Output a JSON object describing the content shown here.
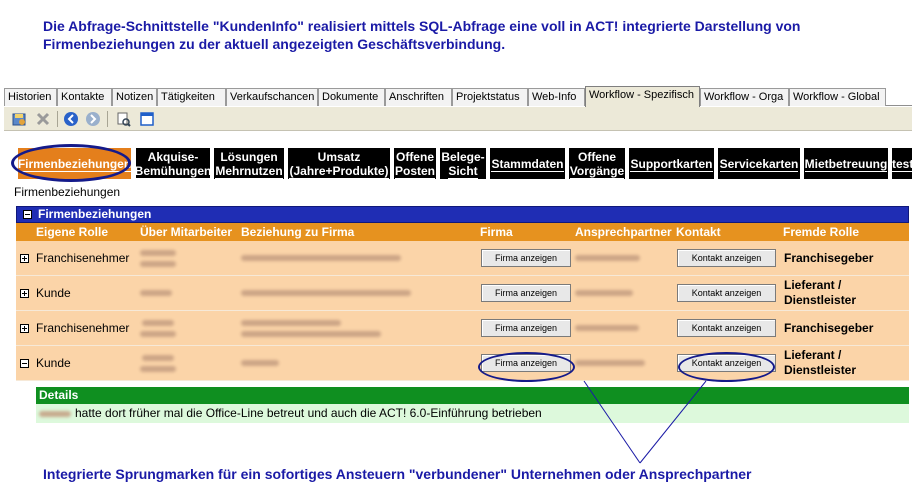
{
  "annotation_top": "Die Abfrage-Schnittstelle \"KundenInfo\" realisiert mittels SQL-Abfrage eine voll in ACT! integrierte Darstellung von Firmenbeziehungen zu der aktuell angezeigten Geschäftsverbindung.",
  "annotation_bottom": "Integrierte Sprungmarken für ein sofortiges Ansteuern \"verbundener\" Unternehmen oder Ansprechpartner",
  "tabs": [
    "Historien",
    "Kontakte",
    "Notizen",
    "Tätigkeiten",
    "Verkaufschancen",
    "Dokumente",
    "Anschriften",
    "Projektstatus",
    "Web-Info",
    "Workflow - Spezifisch",
    "Workflow - Orga",
    "Workflow - Global"
  ],
  "active_tab": "Workflow - Spezifisch",
  "toolbar_icons": [
    "save-icon",
    "delete-icon",
    "back-icon",
    "forward-icon",
    "print-icon",
    "window-icon"
  ],
  "nav_buttons": [
    {
      "line1": "Firmenbeziehungen",
      "line2": ""
    },
    {
      "line1": "Akquise-",
      "line2": "Bemühungen"
    },
    {
      "line1": "Lösungen",
      "line2": "Mehrnutzen"
    },
    {
      "line1": "Umsatz",
      "line2": "(Jahre+Produkte)"
    },
    {
      "line1": "Offene",
      "line2": "Posten"
    },
    {
      "line1": "Belege-",
      "line2": "Sicht"
    },
    {
      "line1": "Stammdaten",
      "line2": ""
    },
    {
      "line1": "Offene",
      "line2": "Vorgänge"
    },
    {
      "line1": "Supportkarten",
      "line2": ""
    },
    {
      "line1": "Servicekarten",
      "line2": ""
    },
    {
      "line1": "Mietbetreuung",
      "line2": ""
    },
    {
      "line1": "test",
      "line2": ""
    }
  ],
  "section_label": "Firmenbeziehungen",
  "grid": {
    "title": "Firmenbeziehungen",
    "columns": [
      "Eigene Rolle",
      "Über Mitarbeiter",
      "Beziehung zu Firma",
      "Firma",
      "Ansprechpartner",
      "Kontakt",
      "Fremde Rolle"
    ],
    "firma_button": "Firma anzeigen",
    "kontakt_button": "Kontakt anzeigen",
    "rows": [
      {
        "role": "Franchisenehmer",
        "foreign_role_1": "Franchisegeber",
        "foreign_role_2": "",
        "expanded": false
      },
      {
        "role": "Kunde",
        "foreign_role_1": "Lieferant /",
        "foreign_role_2": "Dienstleister",
        "expanded": false
      },
      {
        "role": "Franchisenehmer",
        "foreign_role_1": "Franchisegeber",
        "foreign_role_2": "",
        "expanded": false
      },
      {
        "role": "Kunde",
        "foreign_role_1": "Lieferant /",
        "foreign_role_2": "Dienstleister",
        "expanded": true
      }
    ],
    "details_title": "Details",
    "details_text": "hatte dort früher mal die Office-Line betreut und auch die ACT! 6.0-Einführung betrieben"
  },
  "colors": {
    "annotation": "#1a1aa6",
    "grid_title_bar": "#1f2db4",
    "header_bar": "#e6921f",
    "row_bg": "#fbd4a8",
    "details_bar": "#0f8f20",
    "details_bg": "#ddf9dc"
  }
}
